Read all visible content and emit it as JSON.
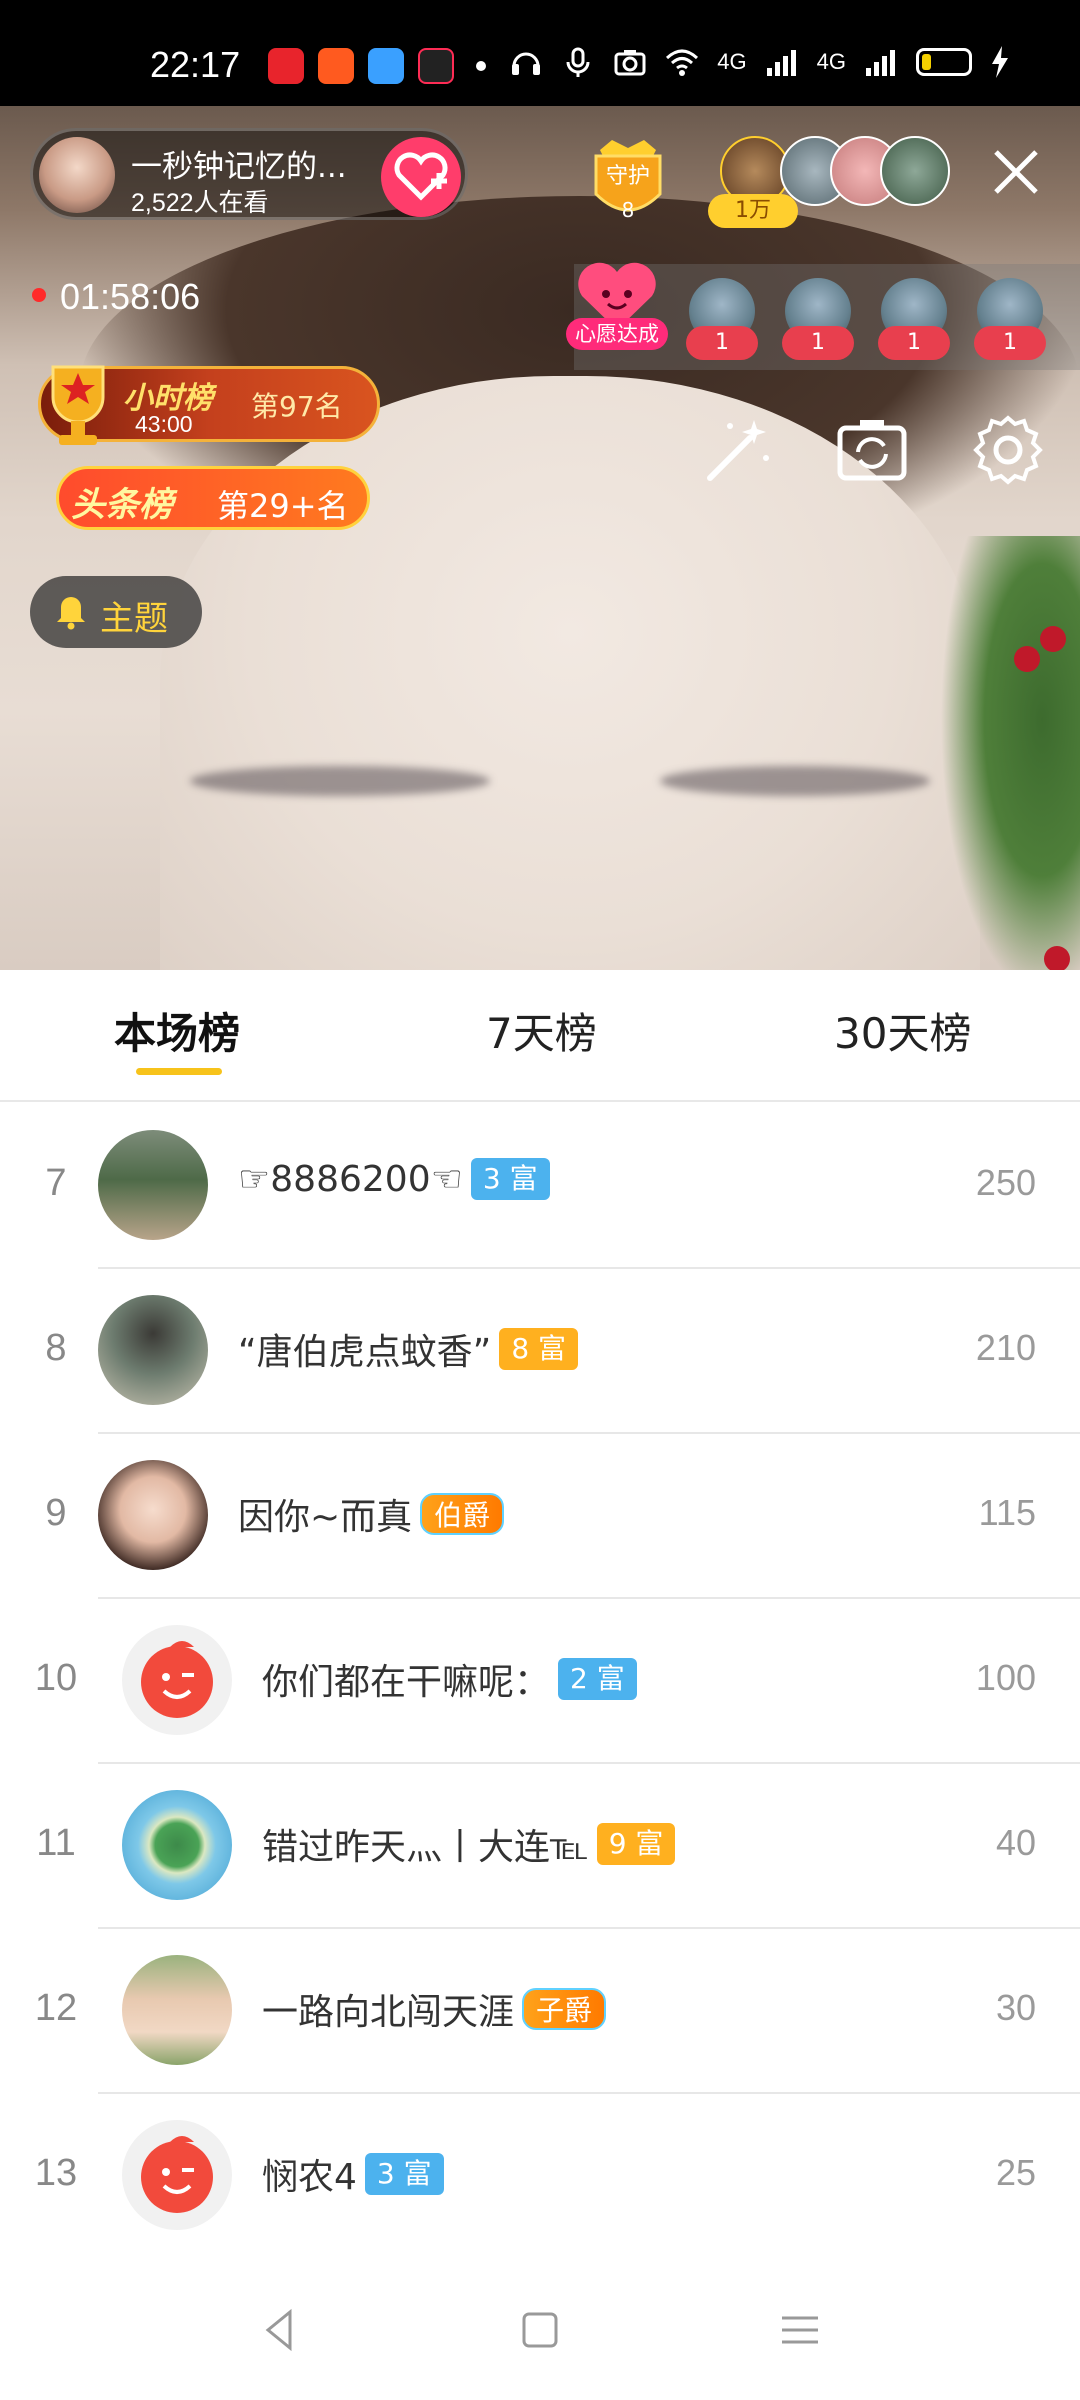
{
  "status_bar": {
    "time": "22:17",
    "network_1": "4G",
    "network_2": "4G",
    "battery_level": 0.2
  },
  "live": {
    "host_name": "一秒钟记忆的...",
    "viewers": "2,522人在看",
    "guard_label": "守护",
    "guard_count": "8",
    "top_tag": "1万",
    "record_time": "01:58:06",
    "wish_label": "心愿达成",
    "wish_gifts": [
      "1",
      "1",
      "1",
      "1"
    ],
    "hour_rank": {
      "title": "小时榜",
      "time": "43:00",
      "place": "第97名"
    },
    "head_rank": {
      "title": "头条榜",
      "place": "第29+名"
    },
    "topic": "主题"
  },
  "tabs": [
    {
      "label": "本场榜",
      "active": true
    },
    {
      "label": "7天榜",
      "active": false
    },
    {
      "label": "30天榜",
      "active": false
    }
  ],
  "ranking": [
    {
      "rank": "7",
      "name": "☞8886200☜",
      "badge": "3 富",
      "badge_color": "#4cb2ee",
      "score": "250",
      "avatar": "road"
    },
    {
      "rank": "8",
      "name": "“唐伯虎点蚊香”",
      "badge": "8 富",
      "badge_color": "#ffb01f",
      "score": "210",
      "avatar": "boy"
    },
    {
      "rank": "9",
      "name": "因你~而真",
      "badge": "伯爵",
      "badge_color": "#ff8c00",
      "score": "115",
      "avatar": "girl"
    },
    {
      "rank": "10",
      "name": "你们都在干嘛呢：",
      "badge": "2 富",
      "badge_color": "#4cb2ee",
      "score": "100",
      "avatar": "default-face"
    },
    {
      "rank": "11",
      "name": "错过昨天灬丨大连℡",
      "badge": "9 富",
      "badge_color": "#ffb01f",
      "score": "40",
      "avatar": "heart-island"
    },
    {
      "rank": "12",
      "name": "一路向北闯天涯",
      "badge": "子爵",
      "badge_color": "#ff8c00",
      "score": "30",
      "avatar": "woman"
    },
    {
      "rank": "13",
      "name": "悯农4",
      "badge": "3 富",
      "badge_color": "#4cb2ee",
      "score": "25",
      "avatar": "default-face"
    }
  ]
}
